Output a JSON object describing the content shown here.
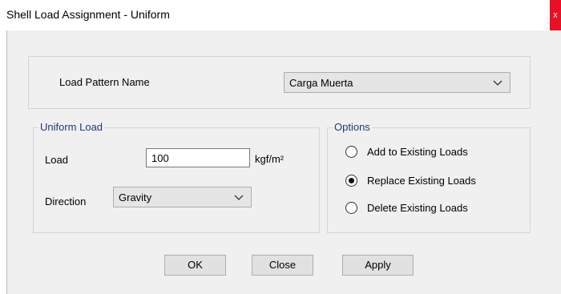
{
  "window": {
    "title": "Shell Load Assignment - Uniform",
    "close_glyph": "x"
  },
  "load_pattern": {
    "label": "Load Pattern Name",
    "selected": "Carga Muerta"
  },
  "uniform_load": {
    "legend": "Uniform Load",
    "load_label": "Load",
    "load_value": "100",
    "load_unit": "kgf/m²",
    "direction_label": "Direction",
    "direction_selected": "Gravity"
  },
  "options": {
    "legend": "Options",
    "items": [
      {
        "label": "Add to Existing Loads",
        "selected": false
      },
      {
        "label": "Replace Existing Loads",
        "selected": true
      },
      {
        "label": "Delete Existing Loads",
        "selected": false
      }
    ]
  },
  "buttons": {
    "ok": "OK",
    "close": "Close",
    "apply": "Apply"
  },
  "colors": {
    "group_legend": "#1e3c78",
    "dialog_bg": "#f0f0f0",
    "close_red": "#e81123"
  }
}
